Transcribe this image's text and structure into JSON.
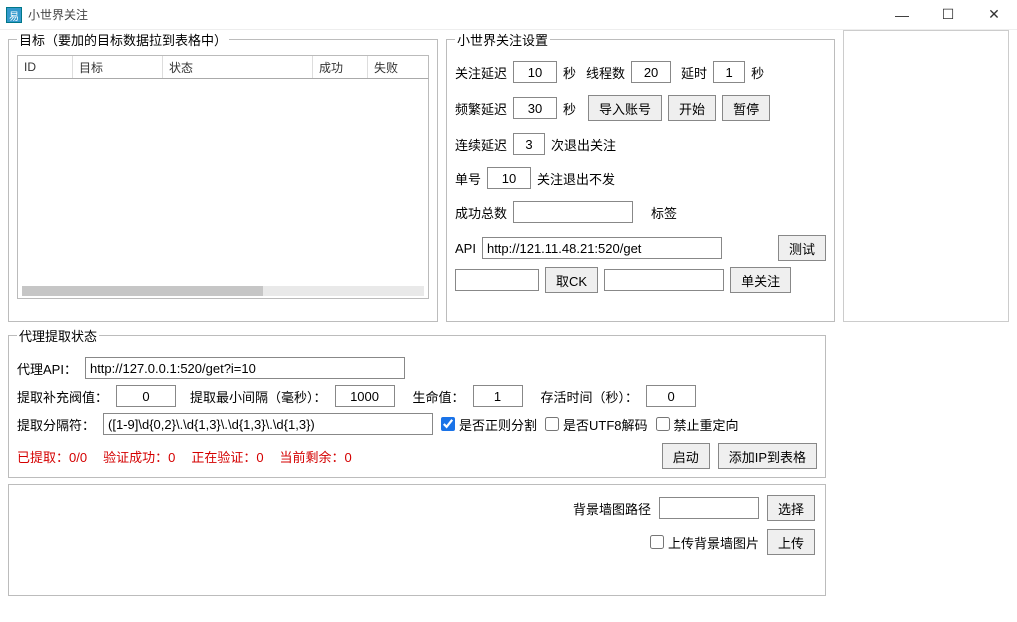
{
  "window": {
    "title": "小世界关注"
  },
  "targets": {
    "legend": "目标（要加的目标数据拉到表格中）",
    "columns": [
      "ID",
      "目标",
      "状态",
      "成功",
      "失败"
    ]
  },
  "settings": {
    "legend": "小世界关注设置",
    "labels": {
      "follow_delay": "关注延迟",
      "sec": "秒",
      "threads": "线程数",
      "delay": "延时",
      "freq_delay": "频繁延迟",
      "import_accounts": "导入账号",
      "start": "开始",
      "pause": "暂停",
      "cont_delay": "连续延迟",
      "exit_follow": "次退出关注",
      "single_num": "单号",
      "follow_exit_nosend": "关注退出不发",
      "success_total": "成功总数",
      "tag": "标签",
      "api": "API",
      "test": "测试",
      "get_ck": "取CK",
      "single_follow": "单关注"
    },
    "values": {
      "follow_delay": "10",
      "threads": "20",
      "delay": "1",
      "freq_delay": "30",
      "cont_delay": "3",
      "single_num": "10",
      "success_total": "",
      "tag": "",
      "api_url": "http://121.11.48.21:520/get",
      "blank1": "",
      "blank2": ""
    }
  },
  "proxy": {
    "legend": "代理提取状态",
    "labels": {
      "proxy_api": "代理API：",
      "refill_threshold": "提取补充阀值：",
      "min_interval": "提取最小间隔（毫秒）：",
      "life_value": "生命值：",
      "alive_time": "存活时间（秒）：",
      "separator": "提取分隔符：",
      "regex_split": "是否正则分割",
      "utf8_decode": "是否UTF8解码",
      "no_redirect": "禁止重定向",
      "launch": "启动",
      "add_ip": "添加IP到表格"
    },
    "values": {
      "proxy_api": "http://127.0.0.1:520/get?i=10",
      "refill_threshold": "0",
      "min_interval": "1000",
      "life_value": "1",
      "alive_time": "0",
      "separator": "([1-9]\\d{0,2}\\.\\d{1,3}\\.\\d{1,3}\\.\\d{1,3})"
    },
    "stats": {
      "extracted": "已提取：0/0",
      "verified": "验证成功：0",
      "verifying": "正在验证：0",
      "remaining": "当前剩余：0"
    }
  },
  "upload": {
    "labels": {
      "bg_path": "背景墙图路径",
      "choose": "选择",
      "upload_bg": "上传背景墙图片",
      "upload": "上传"
    },
    "values": {
      "bg_path": ""
    }
  }
}
